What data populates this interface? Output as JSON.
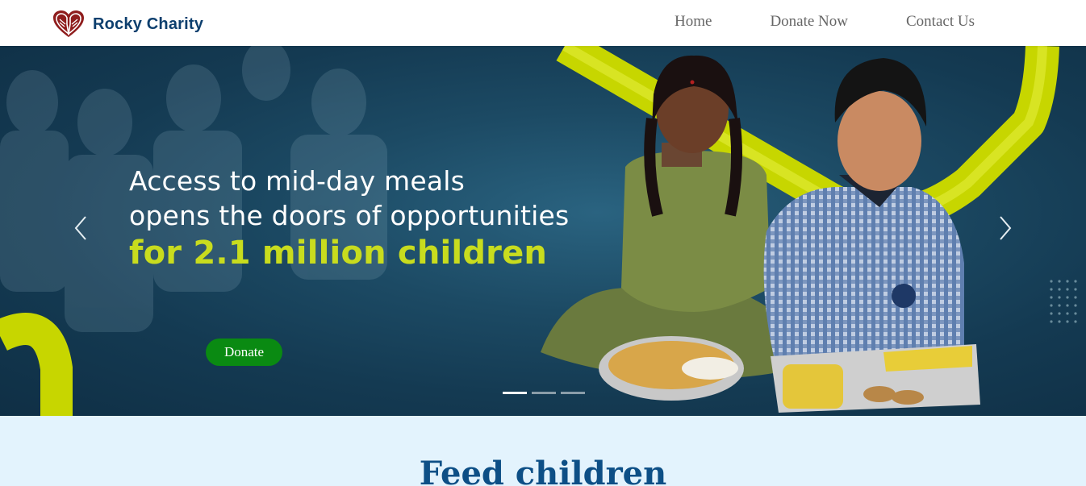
{
  "header": {
    "brand_name": "Rocky Charity",
    "logo_icon": "heart-hands-icon",
    "nav": [
      {
        "label": "Home"
      },
      {
        "label": "Donate Now"
      },
      {
        "label": "Contact Us"
      }
    ]
  },
  "hero": {
    "line1": "Access to mid-day meals",
    "line2": "opens the doors of opportunities",
    "line3": "for 2.1 million children",
    "donate_label": "Donate",
    "prev_icon": "chevron-left-icon",
    "next_icon": "chevron-right-icon",
    "slides_count": 3,
    "active_slide": 1,
    "colors": {
      "accent_text": "#c8dc1e",
      "donate_button": "#0a8a12",
      "background": "#1c4a64"
    }
  },
  "section": {
    "title": "Feed children",
    "background": "#e3f3fd"
  }
}
